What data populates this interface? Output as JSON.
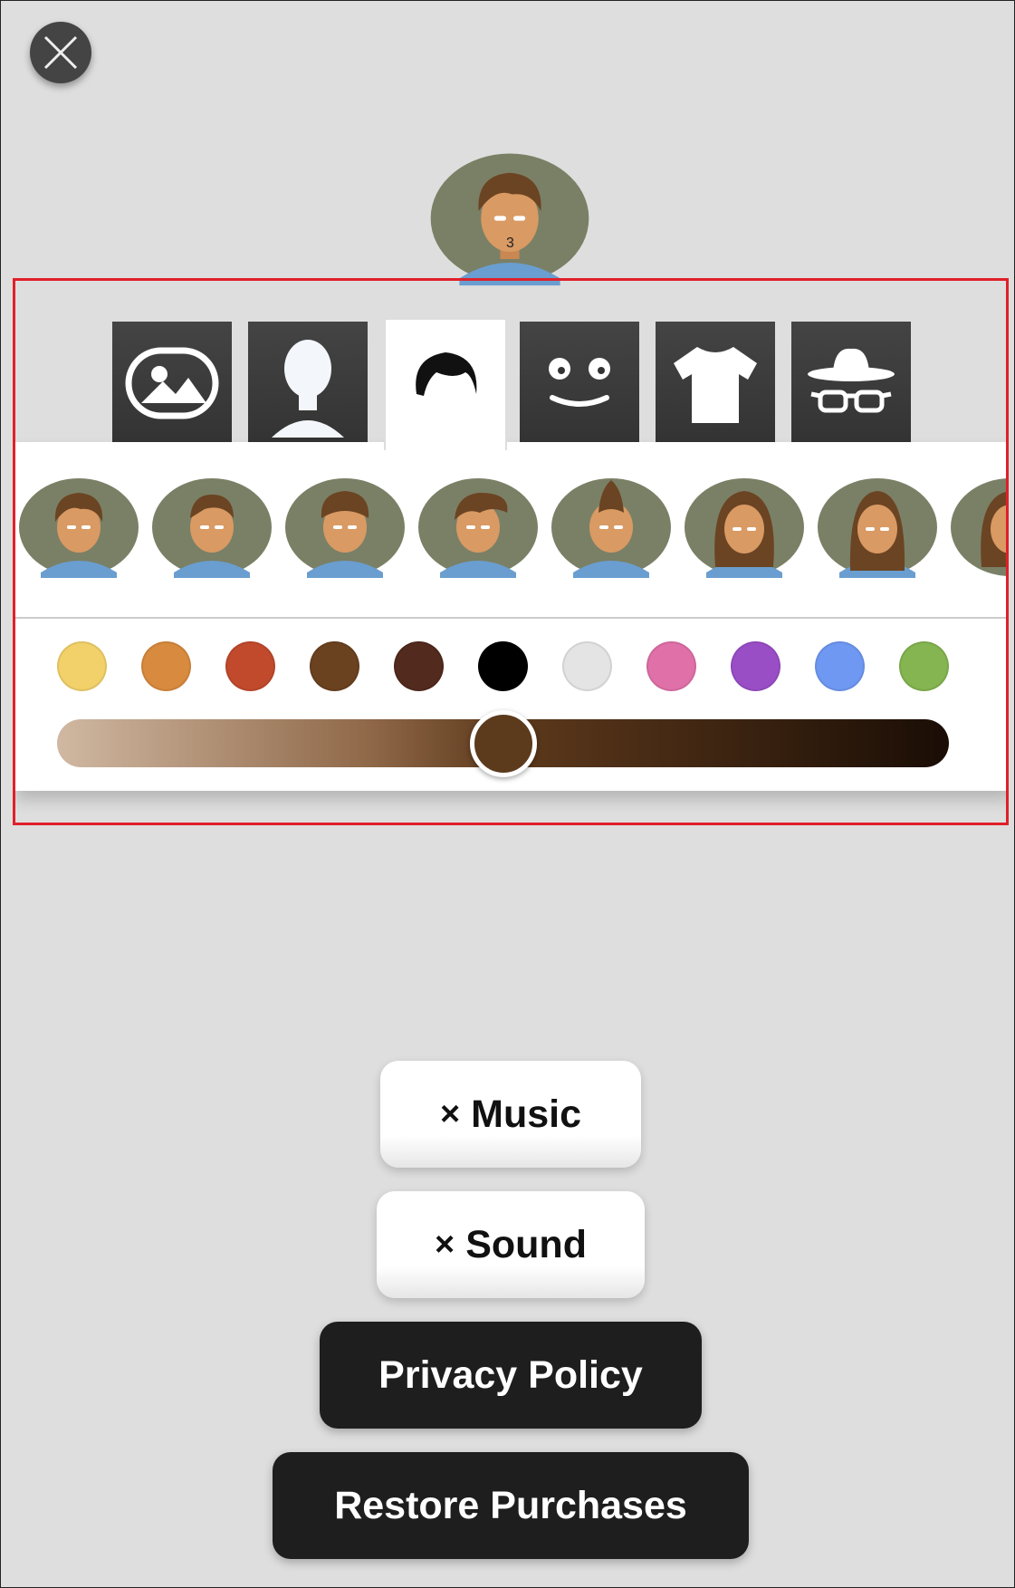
{
  "window": {
    "close_icon": "close-icon"
  },
  "avatar": {
    "icon": "avatar-preview-icon",
    "background": "#7a8066",
    "hair": "#6b4423",
    "skin": "#d99a63",
    "shirt": "#6a9ed0"
  },
  "tabs": [
    {
      "id": "background",
      "icon": "image-icon"
    },
    {
      "id": "body",
      "icon": "person-silhouette-icon"
    },
    {
      "id": "hair",
      "icon": "hair-icon",
      "active": true
    },
    {
      "id": "face",
      "icon": "smiley-face-icon"
    },
    {
      "id": "clothes",
      "icon": "tshirt-icon"
    },
    {
      "id": "accessories",
      "icon": "hat-glasses-icon"
    }
  ],
  "hair_styles": [
    {
      "id": "short-swept"
    },
    {
      "id": "short-parted"
    },
    {
      "id": "curly"
    },
    {
      "id": "side-fringe"
    },
    {
      "id": "mohawk"
    },
    {
      "id": "long-wavy"
    },
    {
      "id": "long-straight"
    },
    {
      "id": "long-partial"
    }
  ],
  "hair_colors": [
    "#f2d16a",
    "#d88a3e",
    "#c24a2c",
    "#6b4220",
    "#532a1e",
    "#000000",
    "#e4e4e4",
    "#e070a8",
    "#9a4ec6",
    "#6e98f2",
    "#84b550"
  ],
  "shade_slider": {
    "value_fraction": 0.5
  },
  "buttons": {
    "music_prefix": "×",
    "music_label": "Music",
    "sound_prefix": "×",
    "sound_label": "Sound",
    "privacy_label": "Privacy Policy",
    "restore_label": "Restore Purchases"
  }
}
